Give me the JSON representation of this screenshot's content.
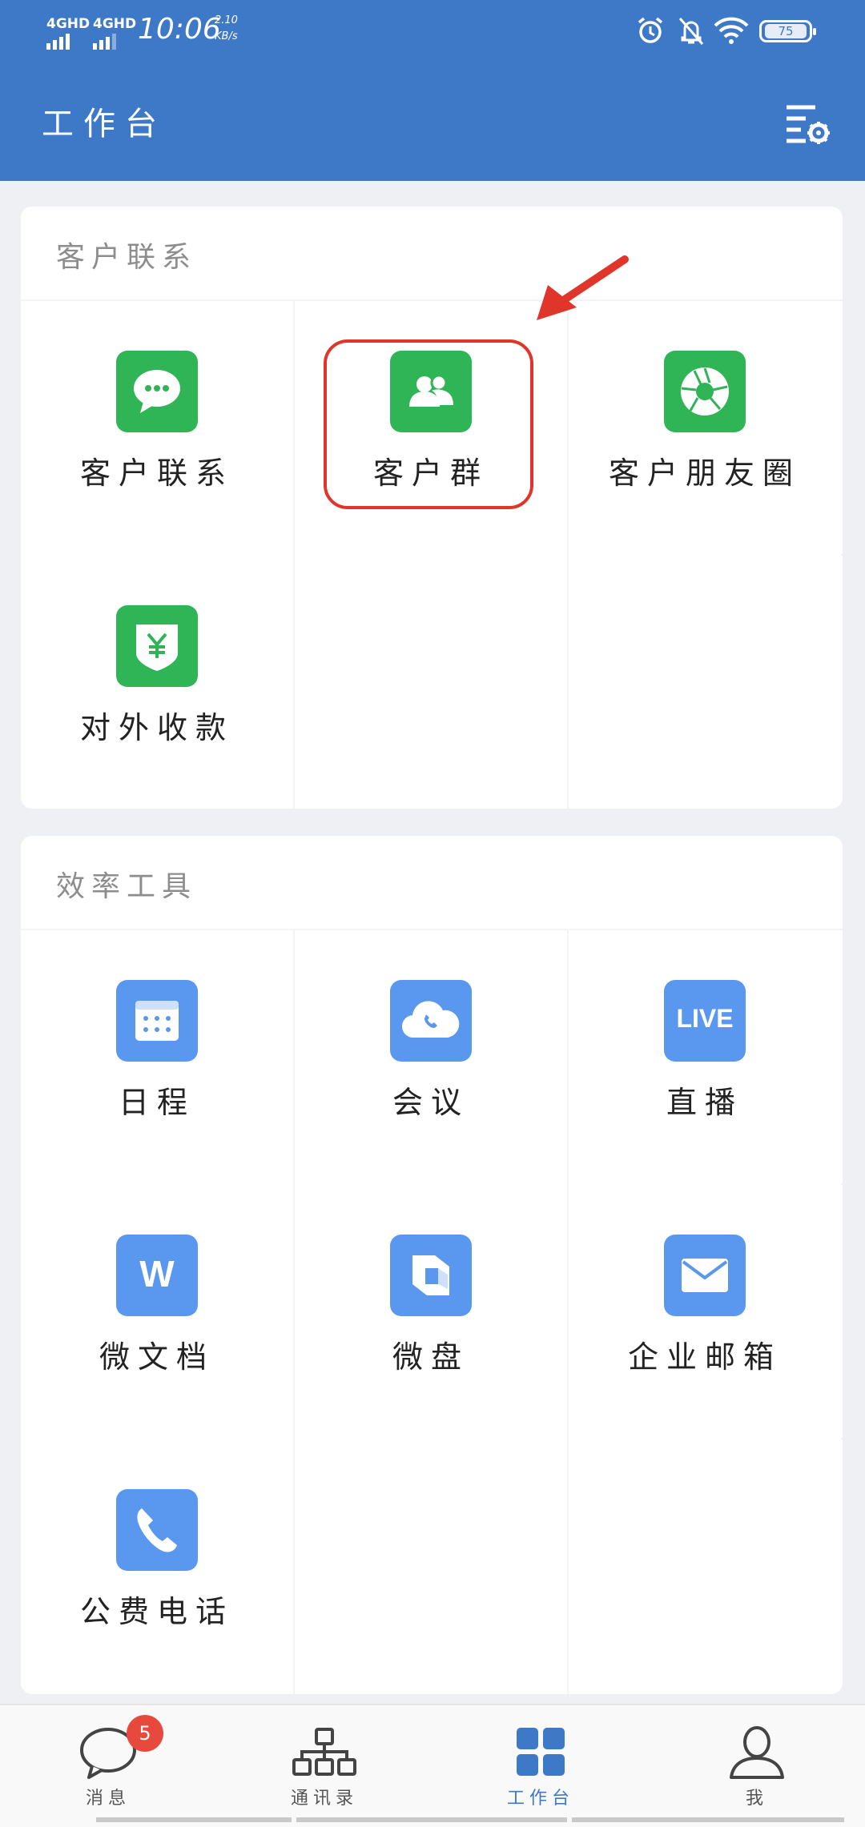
{
  "status_bar": {
    "network_1": "4GHD",
    "network_2": "4GHD",
    "time": "10:06",
    "speed_value": "2.10",
    "speed_unit": "KB/s",
    "battery": "75"
  },
  "header": {
    "title": "工作台",
    "settings_icon": "list-settings-icon"
  },
  "sections": [
    {
      "title": "客户联系",
      "items": [
        {
          "label": "客户联系",
          "icon": "chat-bubble-icon",
          "color": "#2fb456"
        },
        {
          "label": "客户群",
          "icon": "group-icon",
          "color": "#2fb456",
          "highlighted": true
        },
        {
          "label": "客户朋友圈",
          "icon": "shutter-icon",
          "color": "#2fb456"
        },
        {
          "label": "对外收款",
          "icon": "yuan-shield-icon",
          "color": "#2fb456"
        }
      ]
    },
    {
      "title": "效率工具",
      "items": [
        {
          "label": "日程",
          "icon": "calendar-icon",
          "color": "#5a98f0"
        },
        {
          "label": "会议",
          "icon": "cloud-phone-icon",
          "color": "#5a98f0"
        },
        {
          "label": "直播",
          "icon": "live-icon",
          "color": "#5a98f0",
          "icon_text": "LIVE"
        },
        {
          "label": "微文档",
          "icon": "document-w-icon",
          "color": "#5a98f0",
          "icon_text": "W"
        },
        {
          "label": "微盘",
          "icon": "drive-icon",
          "color": "#5a98f0"
        },
        {
          "label": "企业邮箱",
          "icon": "mail-icon",
          "color": "#5a98f0"
        },
        {
          "label": "公费电话",
          "icon": "phone-icon",
          "color": "#5a98f0"
        }
      ]
    }
  ],
  "tabs": [
    {
      "label": "消息",
      "icon": "message-icon",
      "badge": "5"
    },
    {
      "label": "通讯录",
      "icon": "org-chart-icon"
    },
    {
      "label": "工作台",
      "icon": "grid-icon",
      "active": true
    },
    {
      "label": "我",
      "icon": "person-icon"
    }
  ],
  "colors": {
    "header": "#3e79c8",
    "green": "#2fb456",
    "blue": "#5a98f0",
    "highlight": "#e0352b",
    "badge": "#e8493d"
  }
}
